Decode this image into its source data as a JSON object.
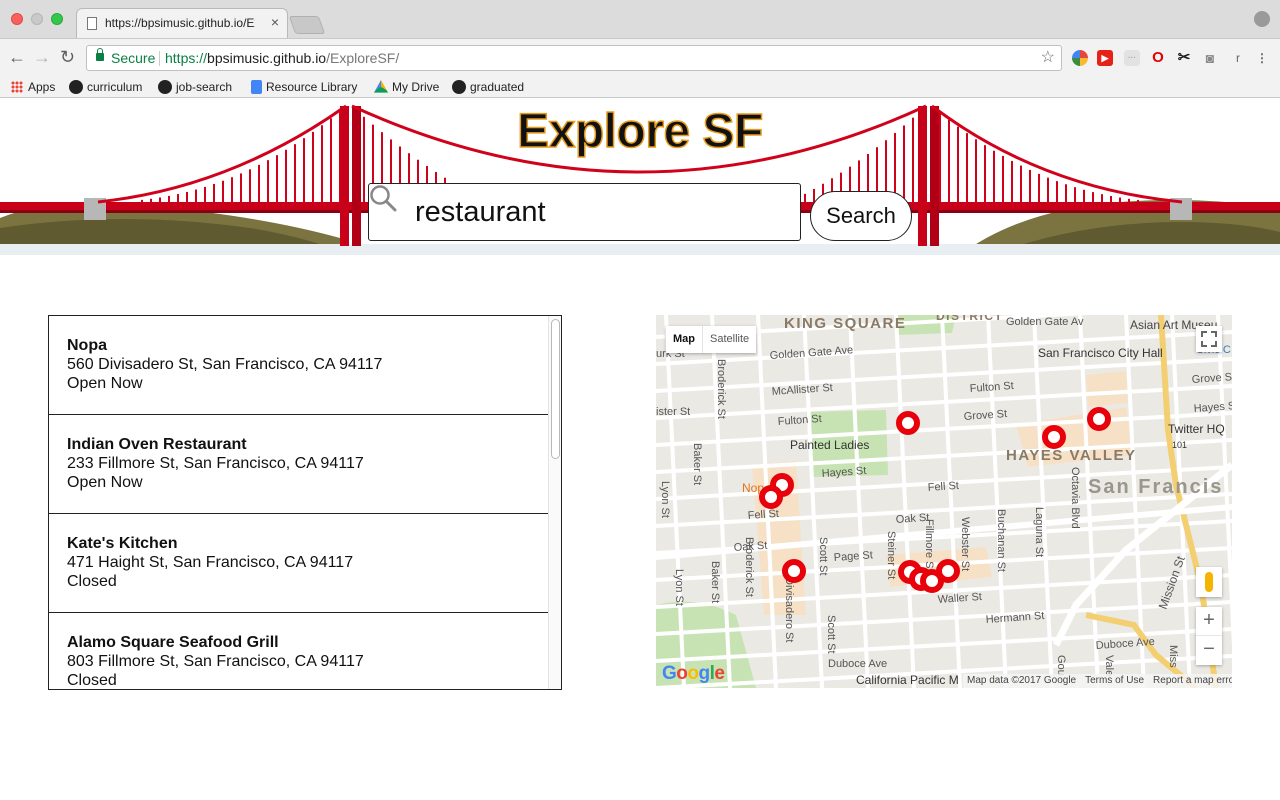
{
  "browser": {
    "tab_title": "https://bpsimusic.github.io/Exp",
    "tab_close": "×",
    "nav": {
      "back": "←",
      "forward": "→",
      "reload": "↻"
    },
    "security_label": "Secure",
    "url_scheme": "https://",
    "url_host": "bpsimusic.github.io",
    "url_path": "/ExploreSF/",
    "bookmark_star": "☆",
    "extensions": [
      "chrome-icon",
      "youtube-icon",
      "blank-ext-icon",
      "opera-icon",
      "scissors-icon",
      "camera-icon",
      "r-ext-icon",
      "menu-icon"
    ],
    "extension_glyphs": {
      "youtube": "▶",
      "blank": "···",
      "opera": "O",
      "scissors": "✂",
      "camera": "◙",
      "r": "r",
      "menu": "⋮"
    },
    "bookmarks": [
      {
        "label": "Apps",
        "icon": "apps-grid-icon"
      },
      {
        "label": "curriculum",
        "icon": "github-icon"
      },
      {
        "label": "job-search",
        "icon": "github-icon"
      },
      {
        "label": "Resource Library",
        "icon": "google-docs-icon"
      },
      {
        "label": "My Drive",
        "icon": "google-drive-icon"
      },
      {
        "label": "graduated",
        "icon": "github-icon"
      }
    ]
  },
  "header": {
    "title": "Explore SF",
    "search_value": "restaurant",
    "search_button": "Search",
    "title_outline_color": "#e69b1e",
    "bridge_color": "#d0021b"
  },
  "results": [
    {
      "name": "Nopa",
      "address": "560 Divisadero St, San Francisco, CA 94117",
      "status": "Open Now"
    },
    {
      "name": "Indian Oven Restaurant",
      "address": "233 Fillmore St, San Francisco, CA 94117",
      "status": "Open Now"
    },
    {
      "name": "Kate's Kitchen",
      "address": "471 Haight St, San Francisco, CA 94117",
      "status": "Closed"
    },
    {
      "name": "Alamo Square Seafood Grill",
      "address": "803 Fillmore St, San Francisco, CA 94117",
      "status": "Closed"
    }
  ],
  "map": {
    "type_options": [
      "Map",
      "Satellite"
    ],
    "selected_type": "Map",
    "zoom_in": "+",
    "zoom_out": "−",
    "logo": [
      "G",
      "o",
      "o",
      "g",
      "l",
      "e"
    ],
    "attribution": [
      "Map data ©2017 Google",
      "Terms of Use",
      "Report a map error"
    ],
    "marker_color": "#e8000b",
    "labels": {
      "king_square": "KING SQUARE",
      "district": "DISTRICT",
      "golden_gate_ave_ne": "Golden Gate Av",
      "asian_art": "Asian Art Museu",
      "civic": "Civic C",
      "sf_city_hall": "San Francisco City Hall",
      "golden_gate_ave": "Golden Gate Ave",
      "mcallister": "McAllister St",
      "fulton_w": "Fulton St",
      "fulton_e": "Fulton St",
      "grove_w": "Grove St",
      "grove_e": "Grove St",
      "hayes_e": "Hayes St",
      "twitter_hq": "Twitter HQ",
      "painted_ladies": "Painted Ladies",
      "hayes_w": "Hayes St",
      "hayes_valley": "HAYES VALLEY",
      "san_francisco": "San Francis",
      "fell_e": "Fell St",
      "fell_w": "Fell St",
      "nopa": "Nop",
      "oak_e": "Oak St",
      "oak_w": "Oak St",
      "page": "Page St",
      "waller": "Waller St",
      "hermann": "Hermann St",
      "duboce_e": "Duboce Ave",
      "duboce_w": "Duboce Ave",
      "california_pacific": "California Pacific M",
      "broderick_n": "Broderick St",
      "broderick_s": "Broderick St",
      "baker_n": "Baker St",
      "baker_s": "Baker St",
      "lyon_n": "Lyon St",
      "lyon_s": "Lyon St",
      "divisadero": "Divisadero St",
      "scott_n": "Scott St",
      "scott_s": "Scott St",
      "steiner": "Steiner St",
      "fillmore": "Fillmore St",
      "webster": "Webster St",
      "buchanan": "Buchanan St",
      "laguna": "Laguna St",
      "octavia": "Octavia Blvd",
      "mission": "Mission St",
      "gough": "Gou",
      "valencia": "Vale",
      "missing": "Miss",
      "ster": "ister St",
      "turk": "urk St",
      "hwy101": "101"
    }
  }
}
